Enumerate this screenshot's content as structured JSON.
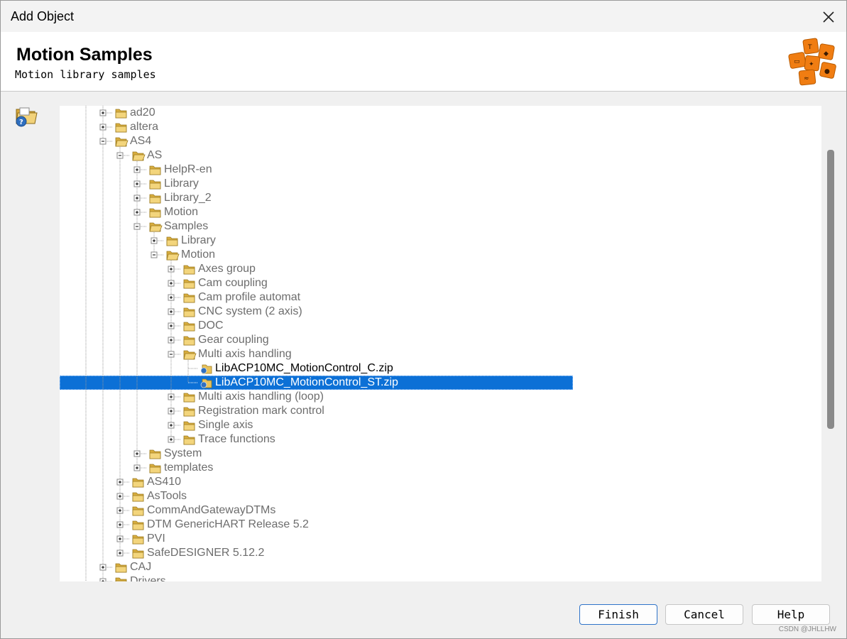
{
  "window": {
    "title": "Add Object"
  },
  "header": {
    "title": "Motion Samples",
    "subtitle": "Motion library samples"
  },
  "icons": {
    "close": "close-icon",
    "logo": "automation-studio-logo",
    "side": "wizard-folder-help-icon",
    "folder_closed": "folder-icon",
    "folder_open": "folder-open-icon",
    "zip_file": "zip-file-icon",
    "expand": "plus-box-icon",
    "collapse": "minus-box-icon"
  },
  "colors": {
    "selection": "#0c70d6",
    "folder": "#e8c25b",
    "tree_text": "#6d6d6d",
    "logo_orange": "#f07d12"
  },
  "tree": [
    {
      "label": "ad20",
      "depth": 0,
      "kind": "folder",
      "state": "collapsed"
    },
    {
      "label": "altera",
      "depth": 0,
      "kind": "folder",
      "state": "collapsed"
    },
    {
      "label": "AS4",
      "depth": 0,
      "kind": "folder",
      "state": "expanded"
    },
    {
      "label": "AS",
      "depth": 1,
      "kind": "folder",
      "state": "expanded"
    },
    {
      "label": "HelpR-en",
      "depth": 2,
      "kind": "folder",
      "state": "collapsed"
    },
    {
      "label": "Library",
      "depth": 2,
      "kind": "folder",
      "state": "collapsed"
    },
    {
      "label": "Library_2",
      "depth": 2,
      "kind": "folder",
      "state": "collapsed"
    },
    {
      "label": "Motion",
      "depth": 2,
      "kind": "folder",
      "state": "collapsed"
    },
    {
      "label": "Samples",
      "depth": 2,
      "kind": "folder",
      "state": "expanded"
    },
    {
      "label": "Library",
      "depth": 3,
      "kind": "folder",
      "state": "collapsed"
    },
    {
      "label": "Motion",
      "depth": 3,
      "kind": "folder",
      "state": "expanded"
    },
    {
      "label": "Axes group",
      "depth": 4,
      "kind": "folder",
      "state": "collapsed"
    },
    {
      "label": "Cam coupling",
      "depth": 4,
      "kind": "folder",
      "state": "collapsed"
    },
    {
      "label": "Cam profile automat",
      "depth": 4,
      "kind": "folder",
      "state": "collapsed"
    },
    {
      "label": "CNC system (2 axis)",
      "depth": 4,
      "kind": "folder",
      "state": "collapsed"
    },
    {
      "label": "DOC",
      "depth": 4,
      "kind": "folder",
      "state": "collapsed"
    },
    {
      "label": "Gear coupling",
      "depth": 4,
      "kind": "folder",
      "state": "collapsed"
    },
    {
      "label": "Multi axis handling",
      "depth": 4,
      "kind": "folder",
      "state": "expanded"
    },
    {
      "label": "LibACP10MC_MotionControl_C.zip",
      "depth": 5,
      "kind": "file",
      "state": "none"
    },
    {
      "label": "LibACP10MC_MotionControl_ST.zip",
      "depth": 5,
      "kind": "file",
      "state": "none",
      "selected": true
    },
    {
      "label": "Multi axis handling (loop)",
      "depth": 4,
      "kind": "folder",
      "state": "collapsed"
    },
    {
      "label": "Registration mark control",
      "depth": 4,
      "kind": "folder",
      "state": "collapsed"
    },
    {
      "label": "Single axis",
      "depth": 4,
      "kind": "folder",
      "state": "collapsed"
    },
    {
      "label": "Trace functions",
      "depth": 4,
      "kind": "folder",
      "state": "collapsed"
    },
    {
      "label": "System",
      "depth": 2,
      "kind": "folder",
      "state": "collapsed"
    },
    {
      "label": "templates",
      "depth": 2,
      "kind": "folder",
      "state": "collapsed"
    },
    {
      "label": "AS410",
      "depth": 1,
      "kind": "folder",
      "state": "collapsed"
    },
    {
      "label": "AsTools",
      "depth": 1,
      "kind": "folder",
      "state": "collapsed"
    },
    {
      "label": "CommAndGatewayDTMs",
      "depth": 1,
      "kind": "folder",
      "state": "collapsed"
    },
    {
      "label": "DTM GenericHART Release 5.2",
      "depth": 1,
      "kind": "folder",
      "state": "collapsed"
    },
    {
      "label": "PVI",
      "depth": 1,
      "kind": "folder",
      "state": "collapsed"
    },
    {
      "label": "SafeDESIGNER 5.12.2",
      "depth": 1,
      "kind": "folder",
      "state": "collapsed"
    },
    {
      "label": "CAJ",
      "depth": 0,
      "kind": "folder",
      "state": "collapsed"
    },
    {
      "label": "Drivers",
      "depth": 0,
      "kind": "folder",
      "state": "collapsed"
    }
  ],
  "buttons": {
    "finish": "Finish",
    "cancel": "Cancel",
    "help": "Help"
  },
  "watermark": "CSDN @JHLLHW"
}
